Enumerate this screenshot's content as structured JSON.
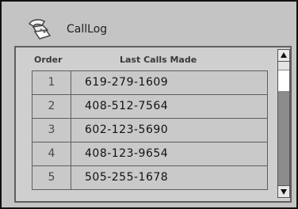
{
  "window": {
    "title": "CallLog",
    "icon": "phone-icon"
  },
  "table": {
    "headers": {
      "order": "Order",
      "last_calls": "Last Calls Made"
    },
    "rows": [
      {
        "order": "1",
        "number": "619-279-1609"
      },
      {
        "order": "2",
        "number": "408-512-7564"
      },
      {
        "order": "3",
        "number": "602-123-5690"
      },
      {
        "order": "4",
        "number": "408-123-9654"
      },
      {
        "order": "5",
        "number": "505-255-1678"
      }
    ]
  },
  "scrollbar": {
    "up_icon": "triangle-up-icon",
    "down_icon": "triangle-down-icon"
  }
}
